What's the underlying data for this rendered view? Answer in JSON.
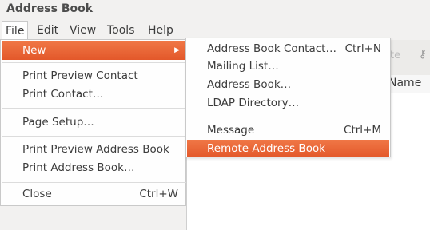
{
  "window": {
    "title": "Address Book"
  },
  "menubar": {
    "items": [
      {
        "label": "File"
      },
      {
        "label": "Edit"
      },
      {
        "label": "View"
      },
      {
        "label": "Tools"
      },
      {
        "label": "Help"
      }
    ]
  },
  "file_menu": {
    "new_label": "New",
    "print_preview_contact": "Print Preview Contact",
    "print_contact": "Print Contact…",
    "page_setup": "Page Setup…",
    "print_preview_address_book": "Print Preview Address Book",
    "print_address_book": "Print Address Book…",
    "close_label": "Close",
    "close_accel": "Ctrl+W"
  },
  "new_submenu": {
    "address_book_contact": "Address Book Contact…",
    "address_book_contact_accel": "Ctrl+N",
    "mailing_list": "Mailing List…",
    "address_book": "Address Book…",
    "ldap_directory": "LDAP Directory…",
    "message": "Message",
    "message_accel": "Ctrl+M",
    "remote_address_book": "Remote Address Book"
  },
  "background": {
    "toolbar_partial_text": "ete",
    "column_header_partial": "Name"
  },
  "colors": {
    "highlight": "#e95f2f",
    "menu_bg": "#fefefe",
    "window_bg": "#f2f1f0"
  }
}
